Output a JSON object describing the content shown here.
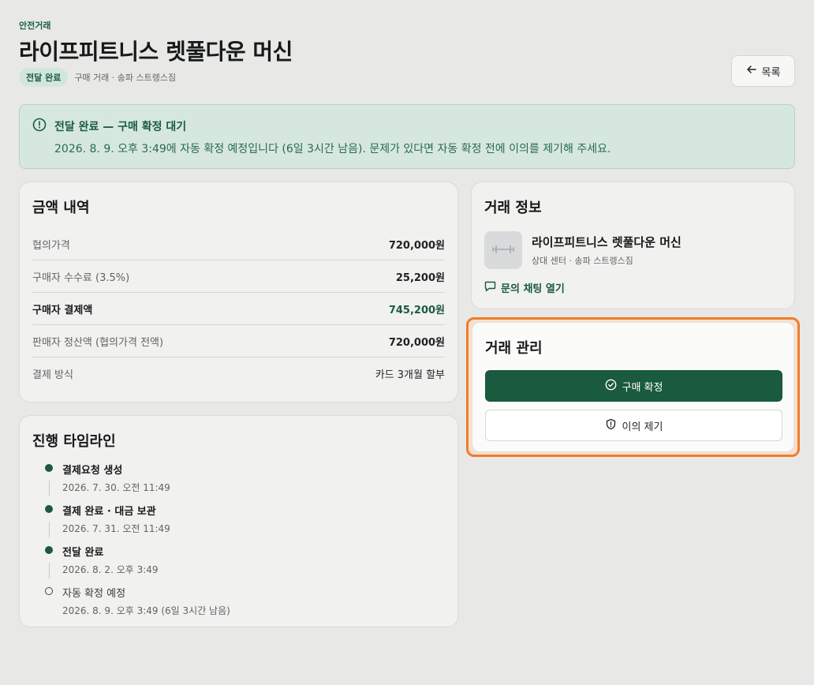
{
  "header": {
    "eyebrow": "안전거래",
    "title": "라이프피트니스 렛풀다운 머신",
    "status_badge": "전달 완료",
    "meta": "구매 거래 · 송파 스트렝스짐",
    "back_label": "목록"
  },
  "alert": {
    "title": "전달 완료 — 구매 확정 대기",
    "body": "2026. 8. 9. 오후 3:49에 자동 확정 예정입니다 (6일 3시간 남음). 문제가 있다면 자동 확정 전에 이의를 제기해 주세요."
  },
  "amounts": {
    "title": "금액 내역",
    "rows": [
      {
        "label": "협의가격",
        "value": "720,000원"
      },
      {
        "label": "구매자 수수료 (3.5%)",
        "value": "25,200원"
      },
      {
        "label": "구매자 결제액",
        "value": "745,200원"
      },
      {
        "label": "판매자 정산액 (협의가격 전액)",
        "value": "720,000원"
      },
      {
        "label": "결제 방식",
        "value": "카드 3개월 할부"
      }
    ]
  },
  "timeline": {
    "title": "진행 타임라인",
    "items": [
      {
        "label": "결제요청 생성",
        "date": "2026. 7. 30. 오전 11:49"
      },
      {
        "label": "결제 완료 · 대금 보관",
        "date": "2026. 7. 31. 오전 11:49"
      },
      {
        "label": "전달 완료",
        "date": "2026. 8. 2. 오후 3:49"
      },
      {
        "label": "자동 확정 예정",
        "date": "2026. 8. 9. 오후 3:49 (6일 3시간 남음)"
      }
    ]
  },
  "info": {
    "title": "거래 정보",
    "product_name": "라이프피트니스 렛풀다운 머신",
    "product_sub": "상대 센터 · 송파 스트렝스짐",
    "chat_label": "문의 채팅 열기"
  },
  "manage": {
    "title": "거래 관리",
    "confirm_label": "구매 확정",
    "dispute_label": "이의 제기"
  },
  "colors": {
    "accent": "#1a5a3f",
    "highlight": "#f07c2a"
  }
}
